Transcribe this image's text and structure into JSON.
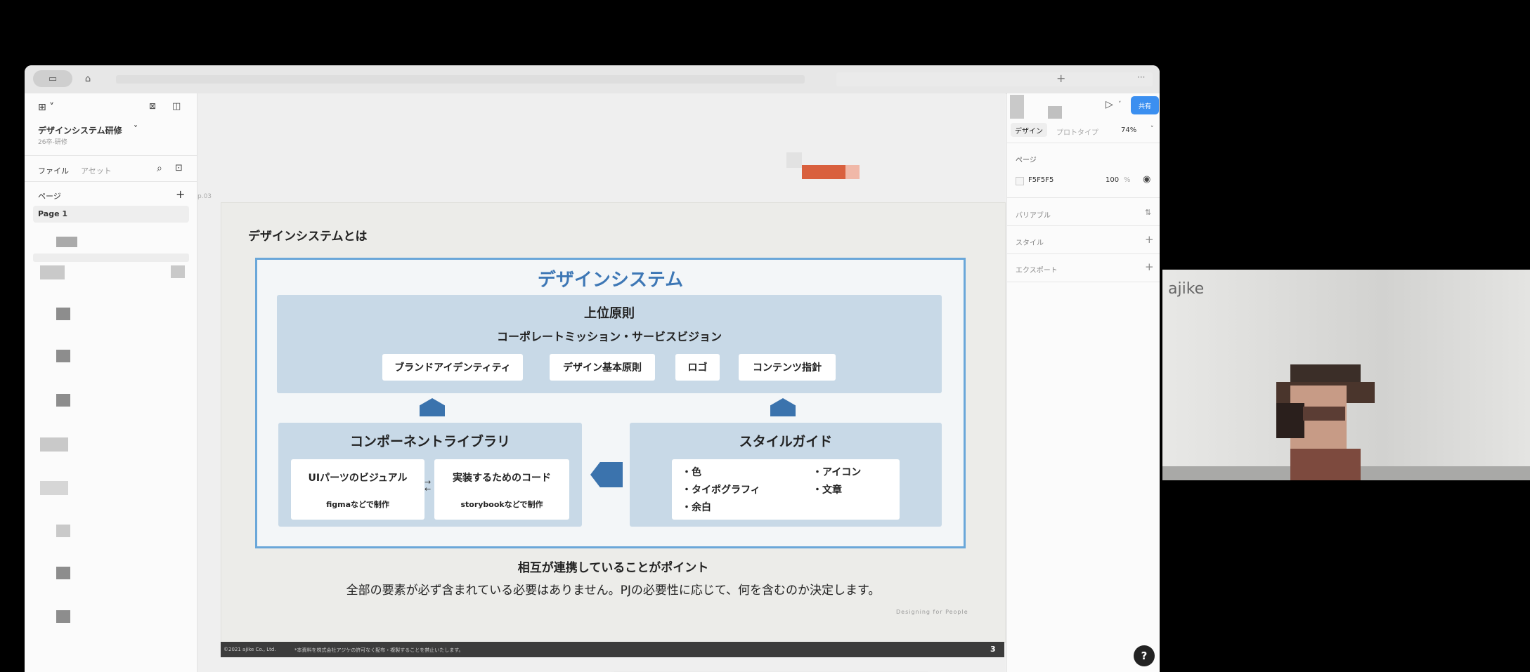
{
  "tabbar": {
    "plus_label": "+",
    "more_label": "···"
  },
  "file": {
    "menu_label": "⊞ ˅",
    "name": "デザインシステム研修",
    "name_chevron": "˅",
    "subtitle": "26卒-研修"
  },
  "left_panel": {
    "tab_files": "ファイル",
    "tab_assets": "アセット",
    "pages_label": "ページ",
    "add_page": "+",
    "current_page": "Page 1"
  },
  "canvas": {
    "frame_label": "p.03"
  },
  "slide": {
    "heading": "デザインシステムとは",
    "diagram_title": "デザインシステム",
    "top_box": {
      "title": "上位原則",
      "subtitle": "コーポレートミッション・サービスビジョン",
      "items": [
        "ブランドアイデンティティ",
        "デザイン基本原則",
        "ロゴ",
        "コンテンツ指針"
      ]
    },
    "component_box": {
      "title": "コンポーネントライブラリ",
      "visual_title": "UIパーツのビジュアル",
      "visual_sub": "figmaなどで制作",
      "code_title": "実装するためのコード",
      "code_sub": "storybookなどで制作"
    },
    "style_box": {
      "title": "スタイルガイド",
      "items": [
        "・色",
        "・タイポグラフィ",
        "・余白",
        "・アイコン",
        "・文章"
      ]
    },
    "point": "相互が連携していることがポイント",
    "note": "全部の要素が必ず含まれている必要はありません。PJの必要性に応じて、何を含むのか決定します。",
    "tagline": "Designing for People",
    "footer_copyright": "©2021 ajike Co., Ltd.",
    "footer_notice": "*本資料を株式会社アジケの許可なく配布・複製することを禁止いたします。",
    "page_number": "3"
  },
  "right_panel": {
    "share_label": "共有",
    "tab_design": "デザイン",
    "tab_prototype": "プロトタイプ",
    "zoom": "74%",
    "page_section": "ページ",
    "bg_color_hex": "F5F5F5",
    "bg_opacity": "100",
    "percent": "%",
    "variables": "バリアブル",
    "styles": "スタイル",
    "export": "エクスポート",
    "help": "?"
  },
  "video": {
    "logo": "ajike"
  },
  "colors": {
    "accent_blue": "#3d77b5",
    "frame_border": "#6aa7d9",
    "share_button": "#3b8ff0",
    "box_fill": "#c8d9e7"
  }
}
